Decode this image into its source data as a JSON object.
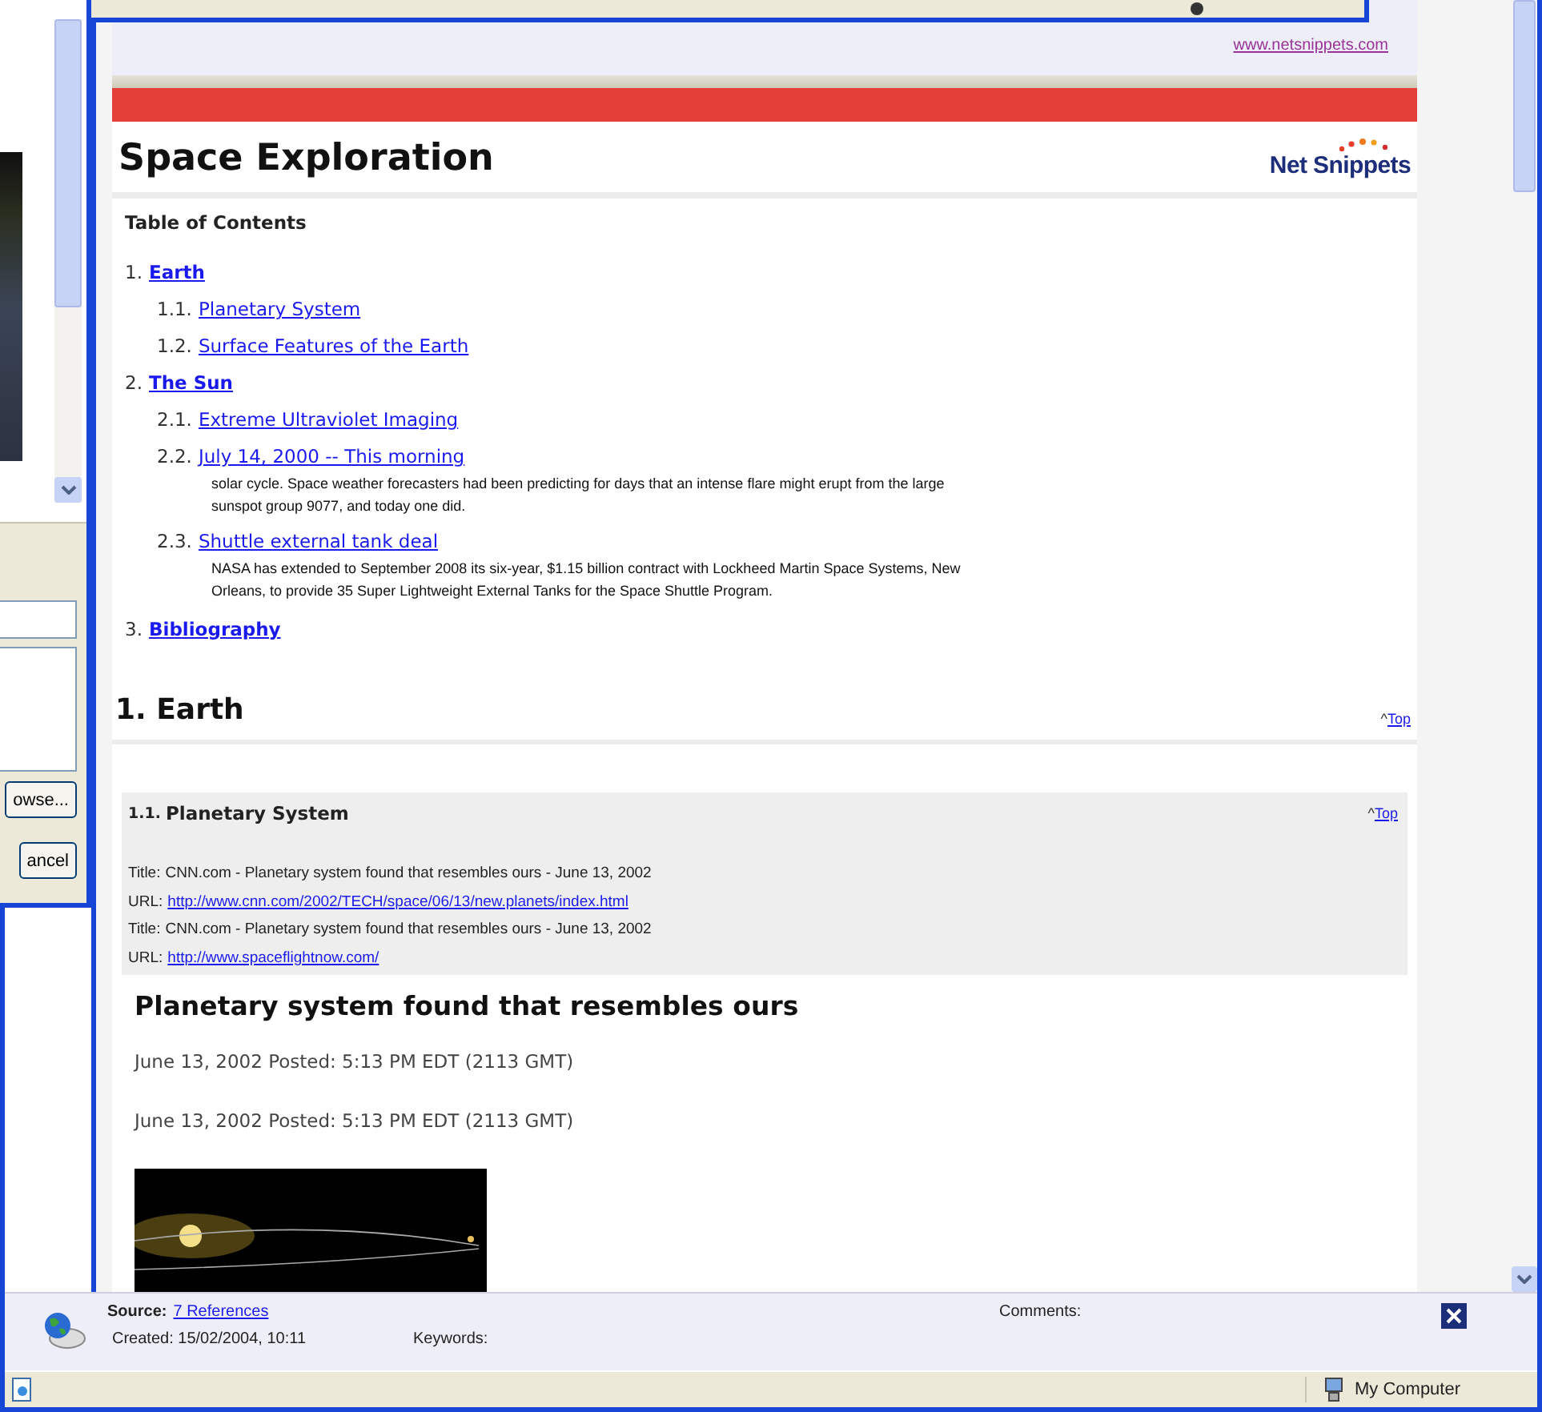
{
  "dialog": {
    "buttons": [
      "owse...",
      "ancel"
    ]
  },
  "page": {
    "site_link": "www.netsnippets.com",
    "title": "Space Exploration",
    "logo": "Net Snippets",
    "toc": {
      "heading": "Table of Contents",
      "items": [
        {
          "number": "1.",
          "label": "Earth",
          "children": [
            {
              "number": "1.1.",
              "label": "Planetary System"
            },
            {
              "number": "1.2.",
              "label": "Surface Features of the Earth"
            }
          ]
        },
        {
          "number": "2.",
          "label": "The Sun",
          "children": [
            {
              "number": "2.1.",
              "label": "Extreme Ultraviolet Imaging"
            },
            {
              "number": "2.2.",
              "label": "July 14, 2000 -- This morning ",
              "summary": "solar cycle. Space weather forecasters had been predicting for days that an intense flare might erupt from the large sunspot group 9077, and today one did."
            },
            {
              "number": "2.3.",
              "label": "Shuttle external tank deal",
              "summary": "NASA has extended to September 2008 its six-year, $1.15 billion contract with Lockheed Martin Space Systems, New Orleans, to provide 35 Super Lightweight External Tanks for the Space Shuttle Program."
            }
          ]
        },
        {
          "number": "3.",
          "label": "Bibliography"
        }
      ]
    },
    "section": {
      "heading": "1. Earth",
      "top": {
        "mark": "^",
        "link": "Top"
      },
      "subsection": {
        "number": "1.1.",
        "heading": "Planetary System",
        "top": {
          "mark": "^",
          "link": "Top"
        },
        "refs": [
          {
            "kind": "text",
            "label": "Title:",
            "value": "CNN.com - Planetary system found that resembles ours - June 13, 2002"
          },
          {
            "kind": "link",
            "label": "URL:",
            "value": "http://www.cnn.com/2002/TECH/space/06/13/new.planets/index.html"
          },
          {
            "kind": "text",
            "label": "Title:",
            "value": "CNN.com - Planetary system found that resembles ours - June 13, 2002"
          },
          {
            "kind": "link",
            "label": "URL:",
            "value": "http://www.spaceflightnow.com/"
          }
        ]
      },
      "article": {
        "title": "Planetary system found that resembles ours",
        "lines": [
          "June 13, 2002 Posted:  5:13 PM EDT (2113 GMT)",
          "June 13, 2002 Posted:  5:13 PM EDT (2113 GMT)"
        ]
      }
    }
  },
  "info": {
    "source_label": "Source:",
    "source_link": "7 References",
    "comments_label": "Comments:",
    "created": "Created: 15/02/2004, 10:11",
    "keywords_label": "Keywords:"
  },
  "status_bar": {
    "zone": "My Computer"
  }
}
